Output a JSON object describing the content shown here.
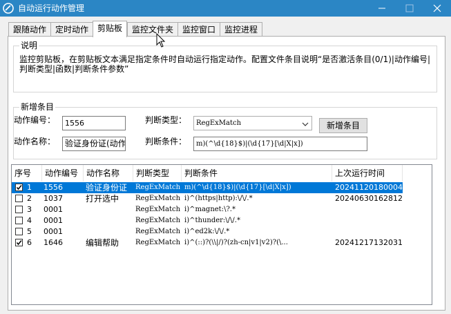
{
  "window": {
    "title": "自动运行动作管理"
  },
  "tabs": [
    {
      "label": "跟随动作"
    },
    {
      "label": "定时动作"
    },
    {
      "label": "剪贴板"
    },
    {
      "label": "监控文件夹"
    },
    {
      "label": "监控窗口"
    },
    {
      "label": "监控进程"
    }
  ],
  "active_tab": "剪贴板",
  "explain": {
    "title": "说明",
    "text": "监控剪贴板，在剪贴板文本满足指定条件时自动运行指定动作。配置文件条目说明“是否激活条目(0/1)|动作编号|判断类型|函数|判断条件参数”"
  },
  "new_entry": {
    "title": "新增条目",
    "action_id_label": "动作编号：",
    "action_id_value": "1556",
    "action_name_label": "动作名称：",
    "action_name_value": "验证身份证(动作",
    "match_type_label": "判断类型：",
    "match_type_value": "RegExMatch",
    "condition_label": "判断条件：",
    "condition_value": "m)(^\\d{18}$)|(\\d{17}[\\d|X|x])",
    "add_button": "新增条目"
  },
  "table": {
    "columns": [
      "序号",
      "动作编号",
      "动作名称",
      "判断类型",
      "判断条件",
      "上次运行时间"
    ],
    "rows": [
      {
        "checked": true,
        "seq": "1",
        "id": "1556",
        "name": "验证身份证",
        "type": "RegExMatch",
        "cond": "m)(^\\d{18}$)|(\\d{17}[\\d|X|x])",
        "last": "20241120180004",
        "selected": true
      },
      {
        "checked": false,
        "seq": "2",
        "id": "1037",
        "name": "打开选中",
        "type": "RegExMatch",
        "cond": "i)^(https|http):\\/\\/.*",
        "last": "20240630162812",
        "selected": false
      },
      {
        "checked": false,
        "seq": "3",
        "id": "0001",
        "name": "",
        "type": "RegExMatch",
        "cond": "i)^magnet:\\?.*",
        "last": "",
        "selected": false
      },
      {
        "checked": false,
        "seq": "4",
        "id": "0001",
        "name": "",
        "type": "RegExMatch",
        "cond": "i)^thunder:\\/\\/.*",
        "last": "",
        "selected": false
      },
      {
        "checked": false,
        "seq": "5",
        "id": "0001",
        "name": "",
        "type": "RegExMatch",
        "cond": "i)^ed2k:\\/\\/.*",
        "last": "",
        "selected": false
      },
      {
        "checked": true,
        "seq": "6",
        "id": "1646",
        "name": "编辑帮助",
        "type": "RegExMatch",
        "cond": "i)^(::)?(\\\\|/)?(zh-cn|v1|v2)?(\\...",
        "last": "20241217132031",
        "selected": false
      }
    ]
  },
  "colors": {
    "titlebar": "#2b86c5",
    "selection": "#0078d7"
  }
}
